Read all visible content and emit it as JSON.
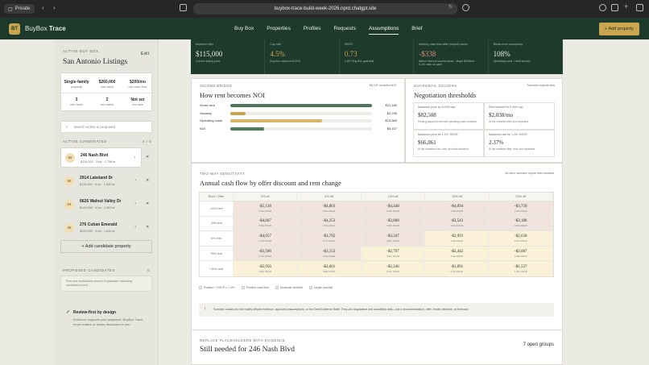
{
  "browser": {
    "private_label": "Private",
    "url": "buybox-trace-build-week-2026.nprd.chatgpt.site"
  },
  "app": {
    "logo": "BT",
    "brand_first": "BuyBox",
    "brand_second": "Trace",
    "nav": [
      "Buy Box",
      "Properties",
      "Profiles",
      "Requests",
      "Assumptions",
      "Brief"
    ],
    "active_nav": "Assumptions",
    "add_property": "+ Add property"
  },
  "sidebar": {
    "active_label": "ACTIVE BUY BOX",
    "edit": "Edit",
    "title": "San Antonio Listings",
    "stats": [
      {
        "v": "Single-family",
        "k": "property"
      },
      {
        "v": "$260,000",
        "k": "max price"
      },
      {
        "v": "$200/mo",
        "k": "min cash flow"
      },
      {
        "v": "3",
        "k": "min beds"
      },
      {
        "v": "2",
        "k": "min baths"
      },
      {
        "v": "Not set",
        "k": "min size"
      }
    ],
    "search_placeholder": "Search active & proposed",
    "candidates_label": "ACTIVE CANDIDATES",
    "candidates_count": "4 / 5",
    "candidates": [
      {
        "score": "56",
        "name": "246 Nash Blvd",
        "detail": "$110,000 · 3 bd · 1,798 sf"
      },
      {
        "score": "56",
        "name": "2914 Lakeland Dr",
        "detail": "$115,000 · 4 bd · 1,003 sf"
      },
      {
        "score": "54",
        "name": "6626 Walnut Valley Dr",
        "detail": "$149,000 · 4 bd · 1,353 sf"
      },
      {
        "score": "46",
        "name": "276 Cuban Emerald",
        "detail": "$229,000 · 3 bd · 1,630 sf"
      }
    ],
    "add_candidate": "+ Add candidate property",
    "proposed_label": "PROPOSED CANDIDATES",
    "proposed_count": "0",
    "proposed_text": "Run one authorized search to populate matching candidates here.",
    "review_title": "Review-first by design",
    "review_text": "Evidence supports your judgment. BuyBox Trace never makes or sends decisions for you."
  },
  "kpis": [
    {
      "l": "Modeled offer",
      "v": "$115,000",
      "s": "Current asking price",
      "c": ""
    },
    {
      "l": "Cap rate",
      "v": "4.5%",
      "s": "Buy-box minimum 6.00%",
      "c": "gold"
    },
    {
      "l": "DSCR",
      "v": "0.73",
      "s": "1.20+ Buy Box guardrail",
      "c": "gold"
    },
    {
      "l": "Monthly cash flow after property taxes",
      "v": "-$338",
      "s": "Before reserve income taxes - target $200/mo · 6.1% cash on cash",
      "c": "red"
    },
    {
      "l": "Break-even occupancy",
      "v": "108%",
      "s": "Operating costs + debt service",
      "c": ""
    }
  ],
  "income": {
    "label": "INCOME BRIDGE",
    "note": "$5,157 modeled NOI",
    "title": "How rent becomes NOI",
    "rows": [
      {
        "k": "Gross rent",
        "pct": 1.0,
        "val": "$21,180",
        "color": "#4d7a5c"
      },
      {
        "k": "Vacancy",
        "pct": 0.11,
        "val": "-$2,236",
        "color": "#c9a54e"
      },
      {
        "k": "Operating costs",
        "pct": 0.65,
        "val": "-$13,883",
        "color": "#d9b66a"
      },
      {
        "k": "NOI",
        "pct": 0.24,
        "val": "$5,157",
        "color": "#4d7a5c"
      }
    ]
  },
  "guardrail": {
    "label": "GUARDRAIL SOLVERS",
    "note": "Scenario outputs only",
    "title": "Negotiation thresholds",
    "cells": [
      {
        "l": "Maximum price for 6.00% cap",
        "v": "$82,508",
        "s": "Holding assumed rent and operating costs constant"
      },
      {
        "l": "Rent needed for 6.00% cap",
        "v": "$2,038/mo",
        "s": "At the modeled offer and expenses"
      },
      {
        "l": "Maximum price for 1.20+ DSCR",
        "v": "$66,861",
        "s": "At the modeled loan, rate, and loan structure"
      },
      {
        "l": "Maximum rate for 1.20+ DSCR",
        "v": "2.37%",
        "s": "At the modeled offer, rent, and expenses"
      }
    ]
  },
  "sensitivity": {
    "label": "TWO-WAY SENSITIVITY",
    "note": "All other scenario inputs held constant",
    "title": "Annual cash flow by offer discount and rent change",
    "corner": "Rent / Offer",
    "cols": [
      "0% off",
      "5% off",
      "10% off",
      "15% off",
      "20% off"
    ],
    "rows": [
      {
        "label": "-10% rent",
        "cells": [
          [
            "-$5,138",
            "0.49x DSCR"
          ],
          [
            "-$4,803",
            "0.53x DSCR"
          ],
          [
            "-$4,448",
            "0.55x DSCR"
          ],
          [
            "-$4,094",
            "0.58x DSCR"
          ],
          [
            "-$3,739",
            "0.62x DSCR"
          ]
        ]
      },
      {
        "label": "-5% rent",
        "cells": [
          [
            "-$4,607",
            "0.53x DSCR"
          ],
          [
            "-$4,253",
            "0.56x DSCR"
          ],
          [
            "-$3,898",
            "0.60x DSCR"
          ],
          [
            "-$3,543",
            "0.64x DSCR"
          ],
          [
            "-$3,188",
            "0.69x DSCR"
          ]
        ]
      },
      {
        "label": "0% rent",
        "cells": [
          [
            "-$4,057",
            "0.73x DSCR"
          ],
          [
            "-$3,702",
            "0.77x DSCR"
          ],
          [
            "-$3,347",
            "0.81x DSCR"
          ],
          [
            "-$2,993",
            "0.86x DSCR"
          ],
          [
            "-$2,638",
            "0.91x DSCR"
          ]
        ]
      },
      {
        "label": "+5% rent",
        "cells": [
          [
            "-$3,506",
            "0.78x DSCR"
          ],
          [
            "-$3,152",
            "0.82x DSCR"
          ],
          [
            "-$2,797",
            "0.87x DSCR"
          ],
          [
            "-$2,442",
            "0.93x DSCR"
          ],
          [
            "-$2,087",
            "0.98x DSCR"
          ]
        ]
      },
      {
        "label": "+10% rent",
        "cells": [
          [
            "-$2,956",
            "0.82x DSCR"
          ],
          [
            "-$2,601",
            "0.86x DSCR"
          ],
          [
            "-$2,246",
            "0.92x DSCR"
          ],
          [
            "-$1,891",
            "0.97x DSCR"
          ],
          [
            "-$1,537",
            "1.03x DSCR"
          ]
        ]
      }
    ],
    "legend": [
      "Positive + DSCR ≥ 1.20+",
      "Positive cash flow",
      "Moderate shortfall",
      "Larger shortfall"
    ],
    "disclaimer": "Scenario values do not modify official evidence, approved assumptions, or the Deal Evidence Brief. They are negotiation and sensitivity aids—not a recommendation, offer, lender decision, or forecast."
  },
  "replace": {
    "label": "REPLACE PLACEHOLDERS WITH EVIDENCE",
    "title": "Still needed for 246 Nash Blvd",
    "count": "7 open groups"
  }
}
